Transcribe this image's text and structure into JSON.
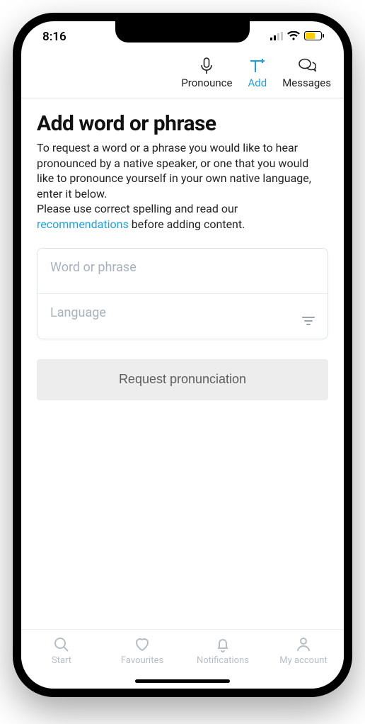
{
  "status": {
    "time": "8:16"
  },
  "topNav": {
    "pronounce": "Pronounce",
    "add": "Add",
    "messages": "Messages"
  },
  "page": {
    "title": "Add word or phrase",
    "desc1": "To request a word or a phrase you would like to hear pronounced by a native speaker, or one that you would like to pronounce yourself in your own native language, enter it below.",
    "desc2a": "Please use correct spelling and read our ",
    "recommendationsLink": "recommendations",
    "desc2b": " before adding content."
  },
  "form": {
    "wordLabel": "Word or phrase",
    "languageLabel": "Language",
    "buttonLabel": "Request pronunciation"
  },
  "bottomNav": {
    "start": "Start",
    "favourites": "Favourites",
    "notifications": "Notifications",
    "account": "My account"
  }
}
